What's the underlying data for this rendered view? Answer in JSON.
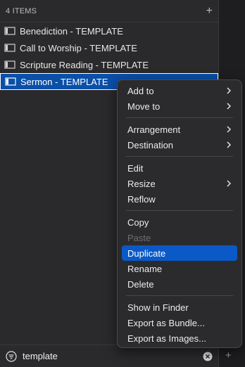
{
  "header": {
    "count_label": "4 ITEMS",
    "add_label": "+"
  },
  "items": [
    {
      "label": "Benediction - TEMPLATE",
      "selected": false
    },
    {
      "label": "Call to Worship - TEMPLATE",
      "selected": false
    },
    {
      "label": "Scripture Reading - TEMPLATE",
      "selected": false
    },
    {
      "label": "Sermon - TEMPLATE",
      "selected": true
    }
  ],
  "context_menu": {
    "add_to": "Add to",
    "move_to": "Move to",
    "arrangement": "Arrangement",
    "destination": "Destination",
    "edit": "Edit",
    "resize": "Resize",
    "reflow": "Reflow",
    "copy": "Copy",
    "paste": "Paste",
    "duplicate": "Duplicate",
    "rename": "Rename",
    "delete": "Delete",
    "show_in_finder": "Show in Finder",
    "export_bundle": "Export as Bundle...",
    "export_images": "Export as Images..."
  },
  "search": {
    "value": "template"
  },
  "footer": {
    "add_label": "+"
  },
  "colors": {
    "selection": "#0a4fa8",
    "menu_highlight": "#0a59c7"
  },
  "icons": {
    "item": "presentation-icon",
    "filter": "filter-icon",
    "clear": "clear-icon",
    "submenu": "chevron-right-icon"
  }
}
